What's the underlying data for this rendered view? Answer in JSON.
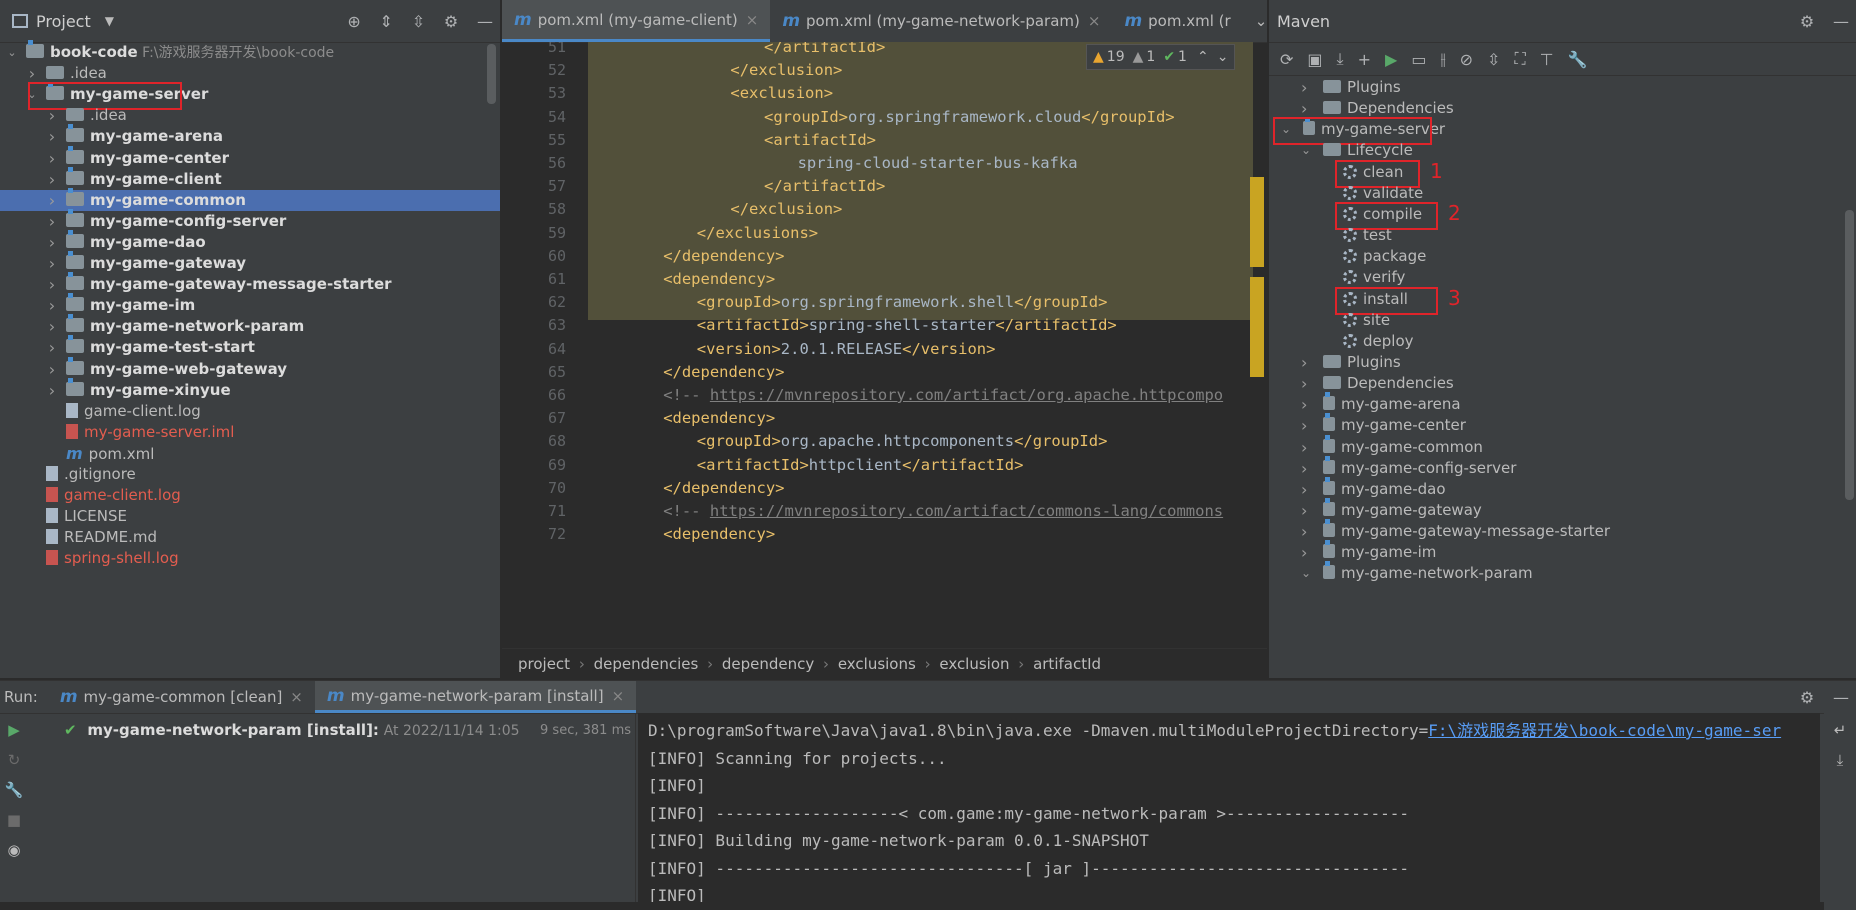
{
  "project_panel": {
    "title": "Project",
    "tree": [
      {
        "label": "book-code",
        "hint": "F:\\游戏服务器开发\\book-code",
        "level": 0,
        "icon": "module-icon",
        "expanded": true,
        "style": "bold"
      },
      {
        "label": ".idea",
        "level": 1,
        "icon": "folder-icon",
        "expanded": false
      },
      {
        "label": "my-game-server",
        "level": 1,
        "icon": "module-icon",
        "expanded": true,
        "style": "bold",
        "highlighted": true
      },
      {
        "label": ".idea",
        "level": 2,
        "icon": "folder-icon",
        "expanded": false
      },
      {
        "label": "my-game-arena",
        "level": 2,
        "icon": "module-icon",
        "expanded": false,
        "style": "bold"
      },
      {
        "label": "my-game-center",
        "level": 2,
        "icon": "module-icon",
        "expanded": false,
        "style": "bold"
      },
      {
        "label": "my-game-client",
        "level": 2,
        "icon": "module-icon",
        "expanded": false,
        "style": "bold"
      },
      {
        "label": "my-game-common",
        "level": 2,
        "icon": "module-icon",
        "expanded": false,
        "style": "bold",
        "selected": true
      },
      {
        "label": "my-game-config-server",
        "level": 2,
        "icon": "module-icon",
        "expanded": false,
        "style": "bold"
      },
      {
        "label": "my-game-dao",
        "level": 2,
        "icon": "module-icon",
        "expanded": false,
        "style": "bold"
      },
      {
        "label": "my-game-gateway",
        "level": 2,
        "icon": "module-icon",
        "expanded": false,
        "style": "bold"
      },
      {
        "label": "my-game-gateway-message-starter",
        "level": 2,
        "icon": "module-icon",
        "expanded": false,
        "style": "bold"
      },
      {
        "label": "my-game-im",
        "level": 2,
        "icon": "module-icon",
        "expanded": false,
        "style": "bold"
      },
      {
        "label": "my-game-network-param",
        "level": 2,
        "icon": "module-icon",
        "expanded": false,
        "style": "bold"
      },
      {
        "label": "my-game-test-start",
        "level": 2,
        "icon": "module-icon",
        "expanded": false,
        "style": "bold"
      },
      {
        "label": "my-game-web-gateway",
        "level": 2,
        "icon": "module-icon",
        "expanded": false,
        "style": "bold"
      },
      {
        "label": "my-game-xinyue",
        "level": 2,
        "icon": "module-icon",
        "expanded": false,
        "style": "bold"
      },
      {
        "label": "game-client.log",
        "level": 2,
        "icon": "file-icon"
      },
      {
        "label": "my-game-server.iml",
        "level": 2,
        "icon": "file-icon",
        "style": "red"
      },
      {
        "label": "pom.xml",
        "level": 2,
        "icon": "maven-file-icon"
      },
      {
        "label": ".gitignore",
        "level": 1,
        "icon": "file-icon"
      },
      {
        "label": "game-client.log",
        "level": 1,
        "icon": "file-icon",
        "style": "red"
      },
      {
        "label": "LICENSE",
        "level": 1,
        "icon": "file-icon"
      },
      {
        "label": "README.md",
        "level": 1,
        "icon": "file-icon"
      },
      {
        "label": "spring-shell.log",
        "level": 1,
        "icon": "file-icon",
        "style": "red"
      }
    ]
  },
  "editor": {
    "tabs": [
      {
        "label": "pom.xml (my-game-client)",
        "active": true
      },
      {
        "label": "pom.xml (my-game-network-param)",
        "active": false
      },
      {
        "label": "pom.xml (r",
        "active": false
      }
    ],
    "inspection": {
      "warnings": "19",
      "weak_warnings": "1",
      "ok": "1"
    },
    "lines": [
      {
        "no": "51",
        "indent": 6,
        "parts": [
          {
            "c": "tag",
            "t": "</artifactId>"
          }
        ]
      },
      {
        "no": "52",
        "indent": 5,
        "parts": [
          {
            "c": "tag",
            "t": "</exclusion>"
          }
        ]
      },
      {
        "no": "53",
        "indent": 5,
        "parts": [
          {
            "c": "tag",
            "t": "<exclusion>"
          }
        ]
      },
      {
        "no": "54",
        "indent": 6,
        "parts": [
          {
            "c": "tag",
            "t": "<groupId>"
          },
          {
            "c": "txt",
            "t": "org.springframework.cloud"
          },
          {
            "c": "tag",
            "t": "</groupId>"
          }
        ]
      },
      {
        "no": "55",
        "indent": 6,
        "parts": [
          {
            "c": "tag",
            "t": "<artifactId>"
          }
        ]
      },
      {
        "no": "56",
        "indent": 7,
        "parts": [
          {
            "c": "txt",
            "t": "spring-cloud-starter-bus-kafka"
          }
        ]
      },
      {
        "no": "57",
        "indent": 6,
        "parts": [
          {
            "c": "tag",
            "t": "</artifactId>"
          }
        ]
      },
      {
        "no": "58",
        "indent": 5,
        "parts": [
          {
            "c": "tag",
            "t": "</exclusion>"
          }
        ]
      },
      {
        "no": "59",
        "indent": 4,
        "parts": [
          {
            "c": "tag",
            "t": "</exclusions>"
          }
        ]
      },
      {
        "no": "60",
        "indent": 3,
        "parts": [
          {
            "c": "tag",
            "t": "</dependency>"
          }
        ]
      },
      {
        "no": "61",
        "indent": 3,
        "parts": [
          {
            "c": "tag",
            "t": "<dependency>"
          }
        ]
      },
      {
        "no": "62",
        "indent": 4,
        "parts": [
          {
            "c": "tag",
            "t": "<groupId>"
          },
          {
            "c": "txt",
            "t": "org.springframework.shell"
          },
          {
            "c": "tag",
            "t": "</groupId>"
          }
        ]
      },
      {
        "no": "63",
        "indent": 4,
        "parts": [
          {
            "c": "tag",
            "t": "<artifactId>"
          },
          {
            "c": "txt",
            "t": "spring-shell-starter"
          },
          {
            "c": "tag",
            "t": "</artifactId>"
          }
        ]
      },
      {
        "no": "64",
        "indent": 4,
        "parts": [
          {
            "c": "tag",
            "t": "<version>"
          },
          {
            "c": "txt",
            "t": "2.0.1.RELEASE"
          },
          {
            "c": "tag",
            "t": "</version>"
          }
        ]
      },
      {
        "no": "65",
        "indent": 3,
        "parts": [
          {
            "c": "tag",
            "t": "</dependency>"
          }
        ]
      },
      {
        "no": "66",
        "indent": 3,
        "parts": [
          {
            "c": "cmt",
            "t": "<!-- "
          },
          {
            "c": "link",
            "t": "https://mvnrepository.com/artifact/org.apache.httpcompo"
          }
        ]
      },
      {
        "no": "67",
        "indent": 3,
        "parts": [
          {
            "c": "tag",
            "t": "<dependency>"
          }
        ]
      },
      {
        "no": "68",
        "indent": 4,
        "parts": [
          {
            "c": "tag",
            "t": "<groupId>"
          },
          {
            "c": "txt",
            "t": "org.apache.httpcomponents"
          },
          {
            "c": "tag",
            "t": "</groupId>"
          }
        ]
      },
      {
        "no": "69",
        "indent": 4,
        "parts": [
          {
            "c": "tag",
            "t": "<artifactId>"
          },
          {
            "c": "txt",
            "t": "httpclient"
          },
          {
            "c": "tag",
            "t": "</artifactId>"
          }
        ]
      },
      {
        "no": "70",
        "indent": 3,
        "parts": [
          {
            "c": "tag",
            "t": "</dependency>"
          }
        ]
      },
      {
        "no": "71",
        "indent": 3,
        "parts": [
          {
            "c": "cmt",
            "t": "<!-- "
          },
          {
            "c": "link",
            "t": "https://mvnrepository.com/artifact/commons-lang/commons"
          }
        ]
      },
      {
        "no": "72",
        "indent": 3,
        "parts": [
          {
            "c": "tag",
            "t": "<dependency>"
          }
        ]
      }
    ],
    "breadcrumb": [
      "project",
      "dependencies",
      "dependency",
      "exclusions",
      "exclusion",
      "artifactId"
    ]
  },
  "maven_panel": {
    "title": "Maven",
    "tree": [
      {
        "label": "Plugins",
        "level": 1,
        "icon": "folder-gear-icon",
        "expanded": false
      },
      {
        "label": "Dependencies",
        "level": 1,
        "icon": "folder-icon",
        "expanded": false
      },
      {
        "label": "my-game-server",
        "level": 0,
        "icon": "maven-module-icon",
        "expanded": true,
        "highlighted": true
      },
      {
        "label": "Lifecycle",
        "level": 1,
        "icon": "folder-gear-icon",
        "expanded": true
      },
      {
        "label": "clean",
        "level": 2,
        "icon": "gear-icon",
        "highlighted": true,
        "annotation": "1"
      },
      {
        "label": "validate",
        "level": 2,
        "icon": "gear-icon"
      },
      {
        "label": "compile",
        "level": 2,
        "icon": "gear-icon",
        "highlighted": true,
        "annotation": "2"
      },
      {
        "label": "test",
        "level": 2,
        "icon": "gear-icon"
      },
      {
        "label": "package",
        "level": 2,
        "icon": "gear-icon"
      },
      {
        "label": "verify",
        "level": 2,
        "icon": "gear-icon"
      },
      {
        "label": "install",
        "level": 2,
        "icon": "gear-icon",
        "highlighted": true,
        "annotation": "3"
      },
      {
        "label": "site",
        "level": 2,
        "icon": "gear-icon"
      },
      {
        "label": "deploy",
        "level": 2,
        "icon": "gear-icon"
      },
      {
        "label": "Plugins",
        "level": 1,
        "icon": "folder-gear-icon",
        "expanded": false
      },
      {
        "label": "Dependencies",
        "level": 1,
        "icon": "folder-icon",
        "expanded": false
      },
      {
        "label": "my-game-arena",
        "level": 1,
        "icon": "maven-module-icon",
        "expanded": false
      },
      {
        "label": "my-game-center",
        "level": 1,
        "icon": "maven-module-icon",
        "expanded": false
      },
      {
        "label": "my-game-common",
        "level": 1,
        "icon": "maven-module-icon",
        "expanded": false
      },
      {
        "label": "my-game-config-server",
        "level": 1,
        "icon": "maven-module-icon",
        "expanded": false
      },
      {
        "label": "my-game-dao",
        "level": 1,
        "icon": "maven-module-icon",
        "expanded": false
      },
      {
        "label": "my-game-gateway",
        "level": 1,
        "icon": "maven-module-icon",
        "expanded": false
      },
      {
        "label": "my-game-gateway-message-starter",
        "level": 1,
        "icon": "maven-module-icon",
        "expanded": false
      },
      {
        "label": "my-game-im",
        "level": 1,
        "icon": "maven-module-icon",
        "expanded": false
      },
      {
        "label": "my-game-network-param",
        "level": 1,
        "icon": "maven-module-icon",
        "expanded": true
      }
    ]
  },
  "run_panel": {
    "label": "Run:",
    "tabs": [
      {
        "label": "my-game-common [clean]",
        "active": false
      },
      {
        "label": "my-game-network-param [install]",
        "active": true
      }
    ],
    "task": {
      "name": "my-game-network-param [install]:",
      "time": "At 2022/11/14 1:05",
      "duration": "9 sec, 381 ms"
    },
    "console": [
      {
        "text": "D:\\programSoftware\\Java\\java1.8\\bin\\java.exe -Dmaven.multiModuleProjectDirectory=",
        "link": "F:\\游戏服务器开发\\book-code\\my-game-ser"
      },
      {
        "text": "[INFO] Scanning for projects..."
      },
      {
        "text": "[INFO]"
      },
      {
        "text": "[INFO] -------------------< com.game:my-game-network-param >-------------------"
      },
      {
        "text": "[INFO] Building my-game-network-param 0.0.1-SNAPSHOT"
      },
      {
        "text": "[INFO] --------------------------------[ jar ]---------------------------------"
      },
      {
        "text": "[INFO]"
      }
    ]
  }
}
